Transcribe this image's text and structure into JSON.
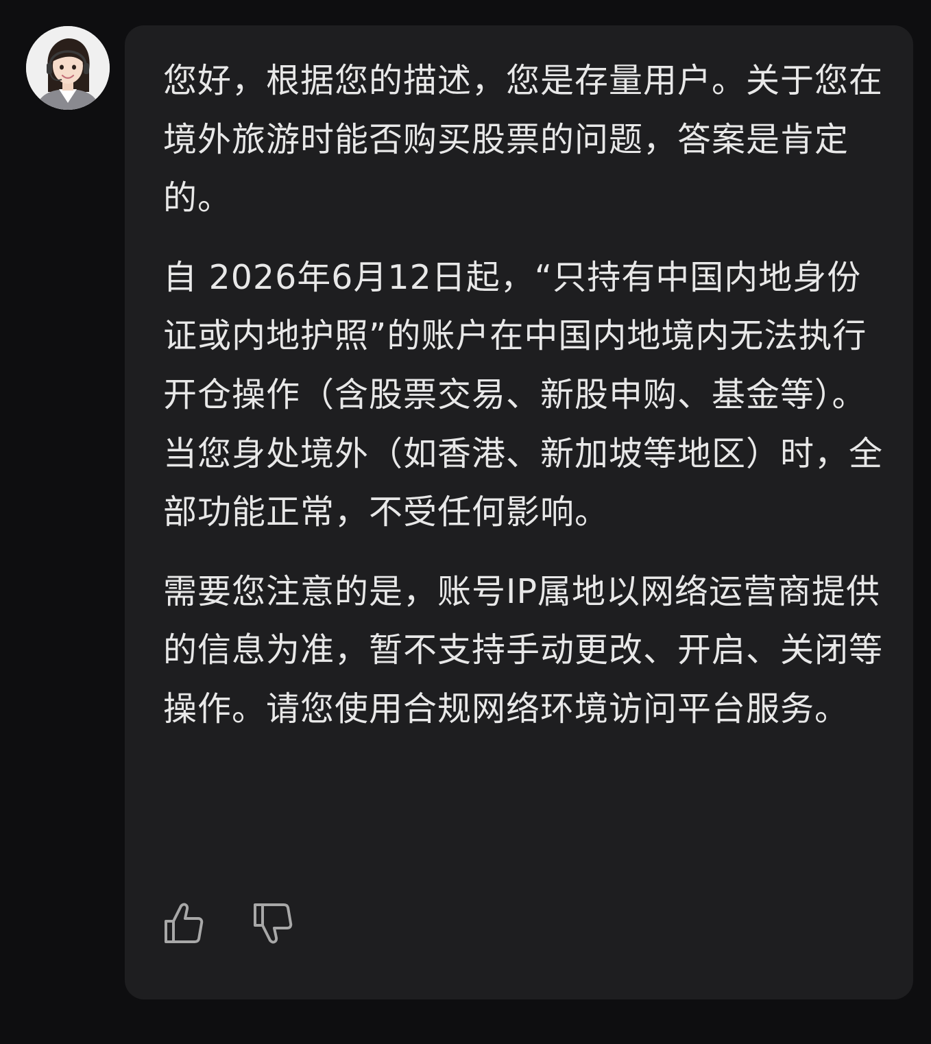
{
  "colors": {
    "page_background": "#0e0e10",
    "bubble_background": "#1e1e20",
    "text": "#e8e8e8",
    "icon_stroke": "#a8a8a8"
  },
  "avatar": {
    "icon": "agent-avatar-with-headset"
  },
  "message": {
    "paragraphs": [
      "您好，根据您的描述，您是存量用户。关于您在境外旅游时能否购买股票的问题，答案是肯定的。",
      "自 2026年6月12日起，“只持有中国内地身份证或内地护照”的账户在中国内地境内无法执行开仓操作（含股票交易、新股申购、基金等）。当您身处境外（如香港、新加坡等地区）时，全部功能正常，不受任何影响。",
      "需要您注意的是，账号IP属地以网络运营商提供的信息为准，暂不支持手动更改、开启、关闭等操作。请您使用合规网络环境访问平台服务。"
    ]
  },
  "feedback": {
    "like_icon": "thumbs-up-icon",
    "dislike_icon": "thumbs-down-icon"
  }
}
